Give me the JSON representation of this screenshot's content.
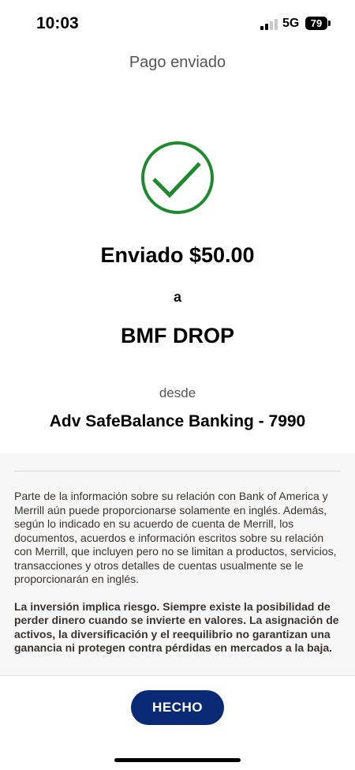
{
  "status_bar": {
    "time": "10:03",
    "network": "5G",
    "battery": "79"
  },
  "header": {
    "title": "Pago enviado"
  },
  "confirmation": {
    "icon": "check-circle-icon",
    "success_color": "#1e8a2e",
    "sent_amount": "Enviado $50.00",
    "to_word": "a",
    "recipient": "BMF DROP",
    "from_word": "desde",
    "account": "Adv SafeBalance Banking - 7990"
  },
  "disclosure": {
    "paragraph_1": "Parte de la información sobre su relación con Bank of America y Merrill aún puede proporcionarse solamente en inglés. Además, según lo indicado en su acuerdo de cuenta de Merrill, los documentos, acuerdos e información escritos sobre su relación con Merrill, que incluyen pero no se limitan a productos, servicios, transacciones y otros detalles de cuentas usualmente se le proporcionarán en inglés.",
    "paragraph_2": "La inversión implica riesgo. Siempre existe la posibilidad de perder dinero cuando se invierte en valores. La asignación de activos, la diversificación y el reequilibrio no garantizan una ganancia ni protegen contra pérdidas en mercados a la baja."
  },
  "actions": {
    "done_label": "HECHO",
    "button_color": "#0a2a75"
  }
}
